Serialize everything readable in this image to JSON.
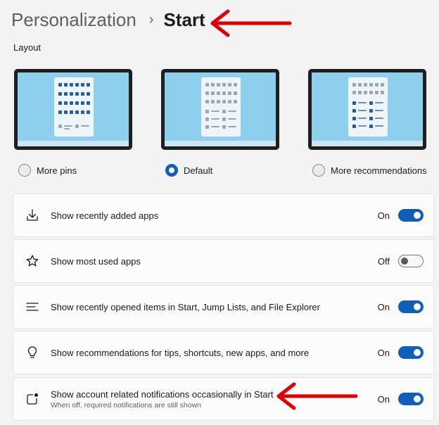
{
  "breadcrumb": {
    "parent": "Personalization",
    "separator": "›",
    "current": "Start"
  },
  "layout": {
    "section_title": "Layout",
    "options": [
      {
        "label": "More pins",
        "selected": false
      },
      {
        "label": "Default",
        "selected": true
      },
      {
        "label": "More recommendations",
        "selected": false
      }
    ]
  },
  "settings": [
    {
      "title": "Show recently added apps",
      "state": "On",
      "icon": "download-icon"
    },
    {
      "title": "Show most used apps",
      "state": "Off",
      "icon": "star-icon"
    },
    {
      "title": "Show recently opened items in Start, Jump Lists, and File Explorer",
      "state": "On",
      "icon": "list-icon"
    },
    {
      "title": "Show recommendations for tips, shortcuts, new apps, and more",
      "state": "On",
      "icon": "lightbulb-icon"
    },
    {
      "title": "Show account related notifications occasionally in Start",
      "desc": "When off, required notifications are still shown",
      "state": "On",
      "icon": "notification-icon"
    }
  ],
  "colors": {
    "accent": "#0f5fb8",
    "annotation_arrow": "#e00000"
  }
}
